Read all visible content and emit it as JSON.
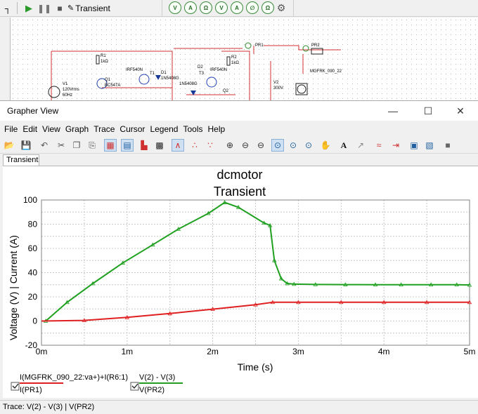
{
  "sim_toolbar": {
    "mode_label": "Transient",
    "meters": [
      "V",
      "A",
      "Ω",
      "V",
      "A",
      "∅",
      "Ω",
      "∅"
    ]
  },
  "schematic": {
    "labels": [
      "R1",
      "1kΩ",
      "IRF540N",
      "T1",
      "D1",
      "1N5408G",
      "Q1",
      "BC547A",
      "V1",
      "120Vrms",
      "60Hz",
      "D2",
      "T3",
      "IRF540N",
      "1N5408G",
      "R2",
      "1kΩ",
      "Q2",
      "PR1",
      "PR2",
      "MGFRK_090_22",
      "V2",
      "300V"
    ]
  },
  "window": {
    "title": "Grapher View",
    "minimize": "—",
    "maximize": "☐",
    "close": "✕"
  },
  "menu": [
    "File",
    "Edit",
    "View",
    "Graph",
    "Trace",
    "Cursor",
    "Legend",
    "Tools",
    "Help"
  ],
  "tabs": [
    {
      "label": "Transient"
    }
  ],
  "colors": {
    "series_green": "#20a020",
    "series_red": "#e02020",
    "grid": "#c8c8c8"
  },
  "chart_data": {
    "type": "line",
    "title": "dcmotor",
    "subtitle": "Transient",
    "xlabel": "Time (s)",
    "ylabel": "Voltage (V) | Current (A)",
    "xlim": [
      0,
      5
    ],
    "ylim": [
      -20,
      100
    ],
    "x_ticks": [
      0,
      1,
      2,
      3,
      4,
      5
    ],
    "x_tick_labels": [
      "0m",
      "1m",
      "2m",
      "3m",
      "4m",
      "5m"
    ],
    "y_ticks": [
      -20,
      0,
      20,
      40,
      60,
      80,
      100
    ],
    "y_tick_labels": [
      "-20",
      "0",
      "20",
      "40",
      "60",
      "80",
      "100"
    ],
    "grid": true,
    "series": [
      {
        "name": "V(2) - V(3)",
        "color": "#20a020",
        "marker": "triangle",
        "x": [
          0,
          0.05,
          0.3,
          0.6,
          0.95,
          1.3,
          1.6,
          1.95,
          2.14,
          2.3,
          2.6,
          2.67,
          2.72,
          2.8,
          2.87,
          2.95,
          3.2,
          3.55,
          3.9,
          4.2,
          4.55,
          4.85,
          5.0
        ],
        "y": [
          0,
          0,
          15.5,
          31,
          48,
          63,
          76,
          89,
          98,
          94,
          81,
          79,
          50,
          35,
          31,
          30.5,
          30.2,
          30.1,
          30,
          30,
          30,
          30,
          29.8
        ]
      },
      {
        "name": "V(PR2)",
        "color": "#e02020",
        "marker": "triangle",
        "x": [
          0,
          0.5,
          1.0,
          1.5,
          2.0,
          2.5,
          2.7,
          3.0,
          3.5,
          4.0,
          4.5,
          5.0
        ],
        "y": [
          0,
          0.5,
          3,
          6.2,
          9.8,
          13.5,
          15.5,
          15.5,
          15.5,
          15.5,
          15.5,
          15.5
        ]
      }
    ],
    "legend": [
      {
        "top": "I(MGFRK_090_22:va+)+I(R6:1)",
        "bottom": "I(PR1)",
        "color": "#e02020"
      },
      {
        "top": "V(2) - V(3)",
        "bottom": "V(PR2)",
        "color": "#20a020"
      }
    ]
  },
  "status": {
    "text": "Trace: V(2) - V(3) | V(PR2)"
  }
}
